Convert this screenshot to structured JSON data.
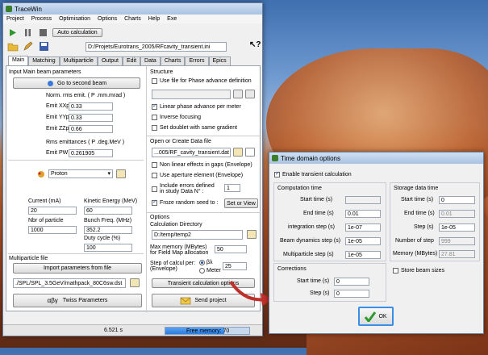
{
  "main": {
    "title": "TraceWin",
    "menu": [
      "Project",
      "Process",
      "Optimisation",
      "Options",
      "Charts",
      "Help",
      "Exe"
    ],
    "auto_calc": "Auto calculation",
    "project_path": "D:/Projets/Eurotrans_2005/RFcavity_transient.ini",
    "tabs": [
      "Main",
      "Matching",
      "Multiparticle",
      "Output",
      "Edit",
      "Data",
      "Charts",
      "Errors",
      "Epics"
    ],
    "input_beam": {
      "header": "Input Main beam parameters",
      "go_second": "Go to second beam",
      "emit_header": "Norm. rms emit. ( P .mm.mrad )",
      "emit_xxp_label": "Emit XXp",
      "emit_xxp": "0.33",
      "emit_yyp_label": "Emit YYp",
      "emit_yyp": "0.33",
      "emit_zzp_label": "Emit ZZp",
      "emit_zzp": "0.66",
      "rms_header": "Rms emittances ( P .deg.MeV )",
      "emit_pw_label": "Emit PW",
      "emit_pw": "0.261905",
      "particle": "Proton",
      "current_label": "Current (mA)",
      "current": "20",
      "ke_label": "Kinetic Energy (MeV)",
      "ke": "60",
      "npart_label": "Nbr of particle",
      "npart": "1000",
      "bunch_label": "Bunch Freq. (MHz)",
      "bunch": "352.2",
      "duty_label": "Duty cycle (%)",
      "duty": "100"
    },
    "multiparticle": {
      "header": "Multiparticle file",
      "import": "Import parameters from file",
      "path": "./SPL/SPL_3.5GeV/mathpack_80C6sw.dst"
    },
    "twiss": "Twiss Parameters",
    "structure": {
      "header": "Structure",
      "use_file": "Use file for Phase advance definition",
      "linear": "Linear phase advance per meter",
      "inverse": "Inverse focusing",
      "doublet": "Set doublet with same gradient"
    },
    "open_data": {
      "header": "Open or Create Data file",
      "path": "...005/RF_cavity_transient.dat",
      "nonlinear": "Non linear effects in gaps (Envelope)",
      "aperture": "Use aperture element (Envelope)",
      "errors_1": "Include errors defined",
      "errors_2": "in study Data N° :",
      "errors_n": "1",
      "froze": "Froze random seed to :",
      "set_view": "Set or View"
    },
    "options": {
      "header": "Options",
      "calc_dir_label": "Calculation Directory",
      "calc_dir": "D:/temp/temp2",
      "mem_label_1": "Max memory (MBytes)",
      "mem_label_2": "for Field Map allocation",
      "mem": "50",
      "step_label_1": "Step of calcul per:",
      "step_label_2": "(Envelope)",
      "step_bl": "βλ",
      "step_meter": "Meter",
      "step": "25",
      "transient": "Transient calculation options"
    },
    "send": "Send project",
    "status_time": "6.521 s",
    "status_mem": "Free memory: 70"
  },
  "dialog": {
    "title": "Time domain options",
    "enable": "Enable transient calculation",
    "computation": {
      "header": "Computation time",
      "start_label": "Start time (s)",
      "start": "",
      "end_label": "End time (s)",
      "end": "0.01",
      "integ_label": "integration step (s)",
      "integ": "1e-07",
      "beam_label": "Beam dynamics step (s)",
      "beam": "1e-05",
      "multi_label": "Multiparticle step (s)",
      "multi": "1e-05"
    },
    "storage": {
      "header": "Storage data time",
      "start_label": "Start time (s)",
      "start": "0",
      "end_label": "End time (s)",
      "end": "0.01",
      "step_label": "Step (s)",
      "step": "1e-05",
      "npoints_label": "Number of step",
      "npoints": "999",
      "mem_label": "Memory (MBytes)",
      "mem": "27.81",
      "store": "Store beam sizes"
    },
    "corrections": {
      "header": "Corrections",
      "start_label": "Start time (s)",
      "start": "0",
      "step_label": "Step (s)",
      "step": "0"
    },
    "ok": "OK"
  }
}
